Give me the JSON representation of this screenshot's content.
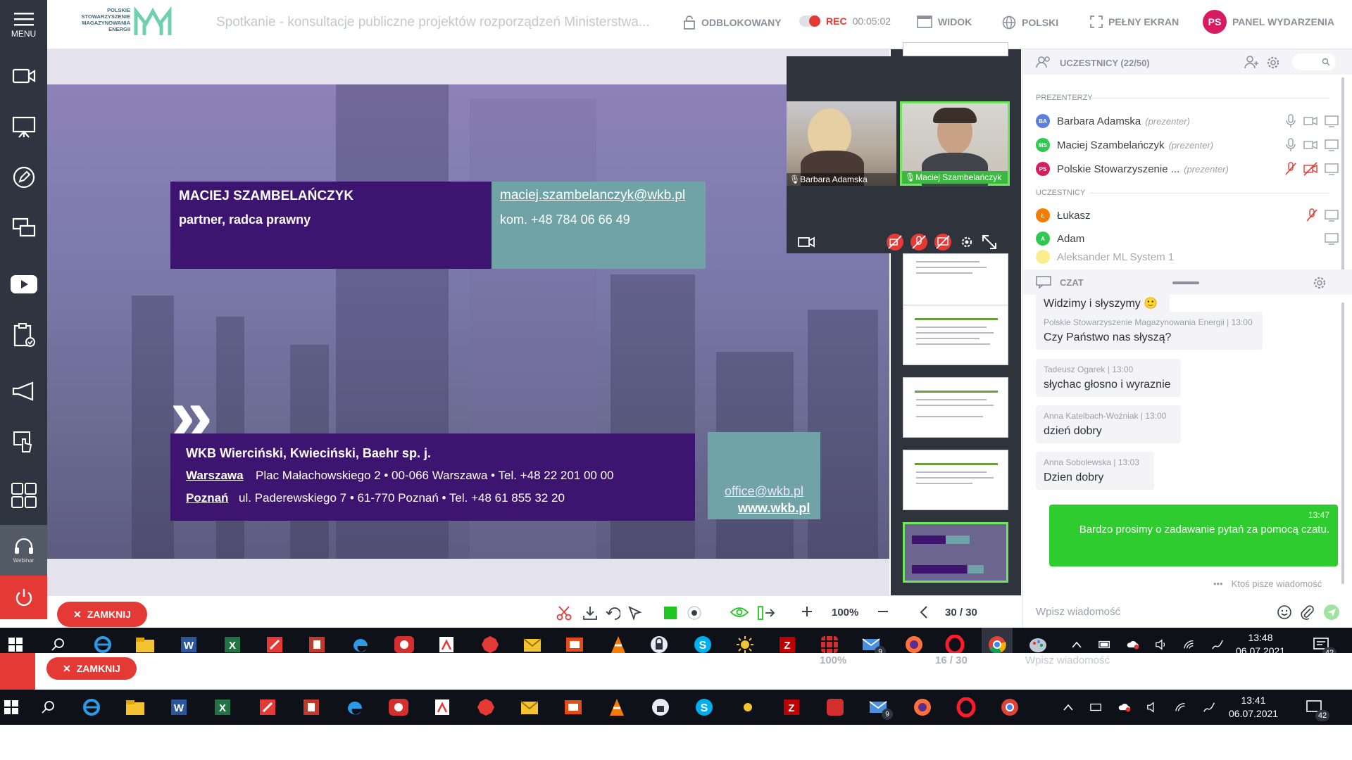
{
  "sidebar": {
    "menu_label": "MENU",
    "webinar_label": "Webinar"
  },
  "topbar": {
    "logo_text": "POLSKIE STOWARZYSZENIE MAGAZYNOWANIA ENERGII",
    "meeting_title": "Spotkanie - konsultacje publiczne projektów rozporządzeń Ministerstwa...",
    "unlocked": "ODBLOKOWANY",
    "rec": "REC",
    "timer": "00:05:02",
    "view": "WIDOK",
    "language": "POLSKI",
    "fullscreen": "PEŁNY EKRAN",
    "avatar_initials": "PS",
    "panel": "PANEL WYDARZENIA"
  },
  "slide": {
    "name": "MACIEJ SZAMBELAŃCZYK",
    "role": "partner, radca prawny",
    "email": "maciej.szambelanczyk@wkb.pl",
    "phone": "kom. +48 784 06 66 49",
    "firm": "WKB Wierciński, Kwieciński, Baehr sp. j.",
    "city1": "Warszawa",
    "addr1": "Plac Małachowskiego 2 • 00-066 Warszawa • Tel. +48 22 201 00 00",
    "city2": "Poznań",
    "addr2": "ul. Paderewskiego 7 • 61-770 Poznań • Tel. +48 61 855 32 20",
    "office_email": "office@wkb.pl",
    "website": "www.wkb.pl"
  },
  "videos": [
    {
      "name": "Barbara Adamska"
    },
    {
      "name": "Maciej Szambelańczyk"
    }
  ],
  "participants": {
    "title": "UCZESTNICY (22/50)",
    "presenters_label": "PREZENTERZY",
    "participants_label": "UCZESTNICY",
    "presenters": [
      {
        "initials": "BA",
        "name": "Barbara Adamska",
        "role": "(prezenter)",
        "color": "#5b7fe0"
      },
      {
        "initials": "MS",
        "name": "Maciej Szambelańczyk",
        "role": "(prezenter)",
        "color": "#2ec94f"
      },
      {
        "initials": "PS",
        "name": "Polskie Stowarzyszenie ...",
        "role": "(prezenter)",
        "color": "#d81b60"
      }
    ],
    "attendees": [
      {
        "initials": "Ł",
        "name": "Łukasz",
        "color": "#f57c00"
      },
      {
        "initials": "A",
        "name": "Adam",
        "color": "#2ec94f"
      },
      {
        "initials": "",
        "name": "Aleksander ML System 1",
        "color": "#f5d800"
      }
    ]
  },
  "chat": {
    "title": "CZAT",
    "partial_message": "Widzimy i słyszymy 🙂",
    "messages": [
      {
        "author": "Polskie Stowarzyszenie Magazynowania Energii",
        "time": "13:00",
        "text": "Czy Państwo nas słyszą?"
      },
      {
        "author": "Tadeusz Ogarek",
        "time": "13:00",
        "text": "słychac głosno i wyraznie"
      },
      {
        "author": "Anna Katelbach-Woźniak",
        "time": "13:00",
        "text": "dzień dobry"
      },
      {
        "author": "Anna Sobolewska",
        "time": "13:03",
        "text": "Dzien dobry"
      }
    ],
    "own_message": {
      "time": "13:47",
      "text": "Bardzo prosimy o zadawanie pytań za pomocą czatu."
    },
    "typing": "Ktoś pisze wiadomość",
    "input_placeholder": "Wpisz wiadomość"
  },
  "toolbar": {
    "close_label": "ZAMKNIJ",
    "zoom": "100%",
    "page": "30 / 30",
    "colors": {
      "accent_green": "#22c422",
      "close_red": "#e53935"
    }
  },
  "taskbar": {
    "time": "13:48",
    "date": "06.07.2021",
    "mail_badge": "9",
    "notif_badge": "42"
  },
  "ghost": {
    "close_label": "ZAMKNIJ",
    "zoom": "100%",
    "page": "16 / 30",
    "input_placeholder": "Wpisz wiadomość",
    "time": "13:41",
    "date": "06.07.2021",
    "mail_badge": "9",
    "notif_badge": "42"
  }
}
